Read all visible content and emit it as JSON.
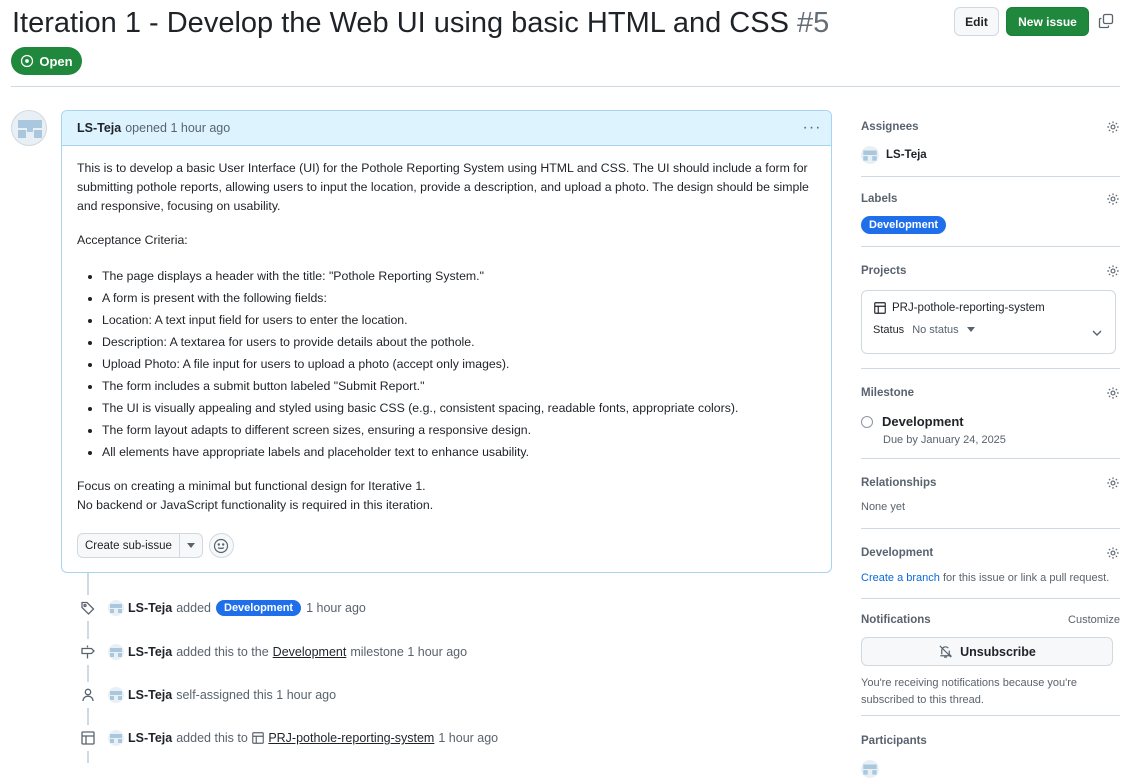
{
  "issue": {
    "title": "Iteration 1 - Develop the Web UI using basic HTML and CSS",
    "number": "#5",
    "state": "Open"
  },
  "header_actions": {
    "edit_label": "Edit",
    "new_issue_label": "New issue"
  },
  "comment": {
    "author": "LS-Teja",
    "action": "opened",
    "time": "1 hour ago",
    "body_intro": "This is to develop a basic User Interface (UI) for the Pothole Reporting System using HTML and CSS. The UI should include a form for submitting pothole reports, allowing users to input the location, provide a description, and upload a photo. The design should be simple and responsive, focusing on usability.",
    "criteria_heading": "Acceptance Criteria:",
    "criteria": [
      "The page displays a header with the title: \"Pothole Reporting System.\"",
      "A form is present with the following fields:",
      "Location: A text input field for users to enter the location.",
      "Description: A textarea for users to provide details about the pothole.",
      "Upload Photo: A file input for users to upload a photo (accept only images).",
      "The form includes a submit button labeled \"Submit Report.\"",
      "The UI is visually appealing and styled using basic CSS (e.g., consistent spacing, readable fonts, appropriate colors).",
      "The form layout adapts to different screen sizes, ensuring a responsive design.",
      "All elements have appropriate labels and placeholder text to enhance usability."
    ],
    "closing_1": "Focus on creating a minimal but functional design for Iterative 1.",
    "closing_2": "No backend or JavaScript functionality is required in this iteration.",
    "create_subissue_label": "Create sub-issue"
  },
  "timeline": {
    "item1": {
      "author": "LS-Teja",
      "action": "added",
      "label": "Development",
      "time": "1 hour ago"
    },
    "item2": {
      "author": "LS-Teja",
      "action": "added this to the",
      "link": "Development",
      "suffix": "milestone",
      "time": "1 hour ago"
    },
    "item3": {
      "author": "LS-Teja",
      "action": "self-assigned this",
      "time": "1 hour ago"
    },
    "item4": {
      "author": "LS-Teja",
      "action": "added this to",
      "link": "PRJ-pothole-reporting-system",
      "time": "1 hour ago"
    }
  },
  "sidebar": {
    "assignees": {
      "heading": "Assignees",
      "user": "LS-Teja"
    },
    "labels": {
      "heading": "Labels",
      "label": "Development"
    },
    "projects": {
      "heading": "Projects",
      "project_name": "PRJ-pothole-reporting-system",
      "status_label": "Status",
      "status_value": "No status"
    },
    "milestone": {
      "heading": "Milestone",
      "name": "Development",
      "due": "Due by January 24, 2025"
    },
    "relationships": {
      "heading": "Relationships",
      "value": "None yet"
    },
    "development": {
      "heading": "Development",
      "link": "Create a branch",
      "text": "for this issue or link a pull request."
    },
    "notifications": {
      "heading": "Notifications",
      "customize": "Customize",
      "button": "Unsubscribe",
      "text": "You're receiving notifications because you're subscribed to this thread."
    },
    "participants": {
      "heading": "Participants"
    }
  },
  "colors": {
    "open_green": "#1f883d",
    "label_blue": "#1f6feb",
    "header_blue_bg": "#ddf4ff",
    "header_blue_border": "#a8d4f2",
    "link_blue": "#0969da"
  }
}
